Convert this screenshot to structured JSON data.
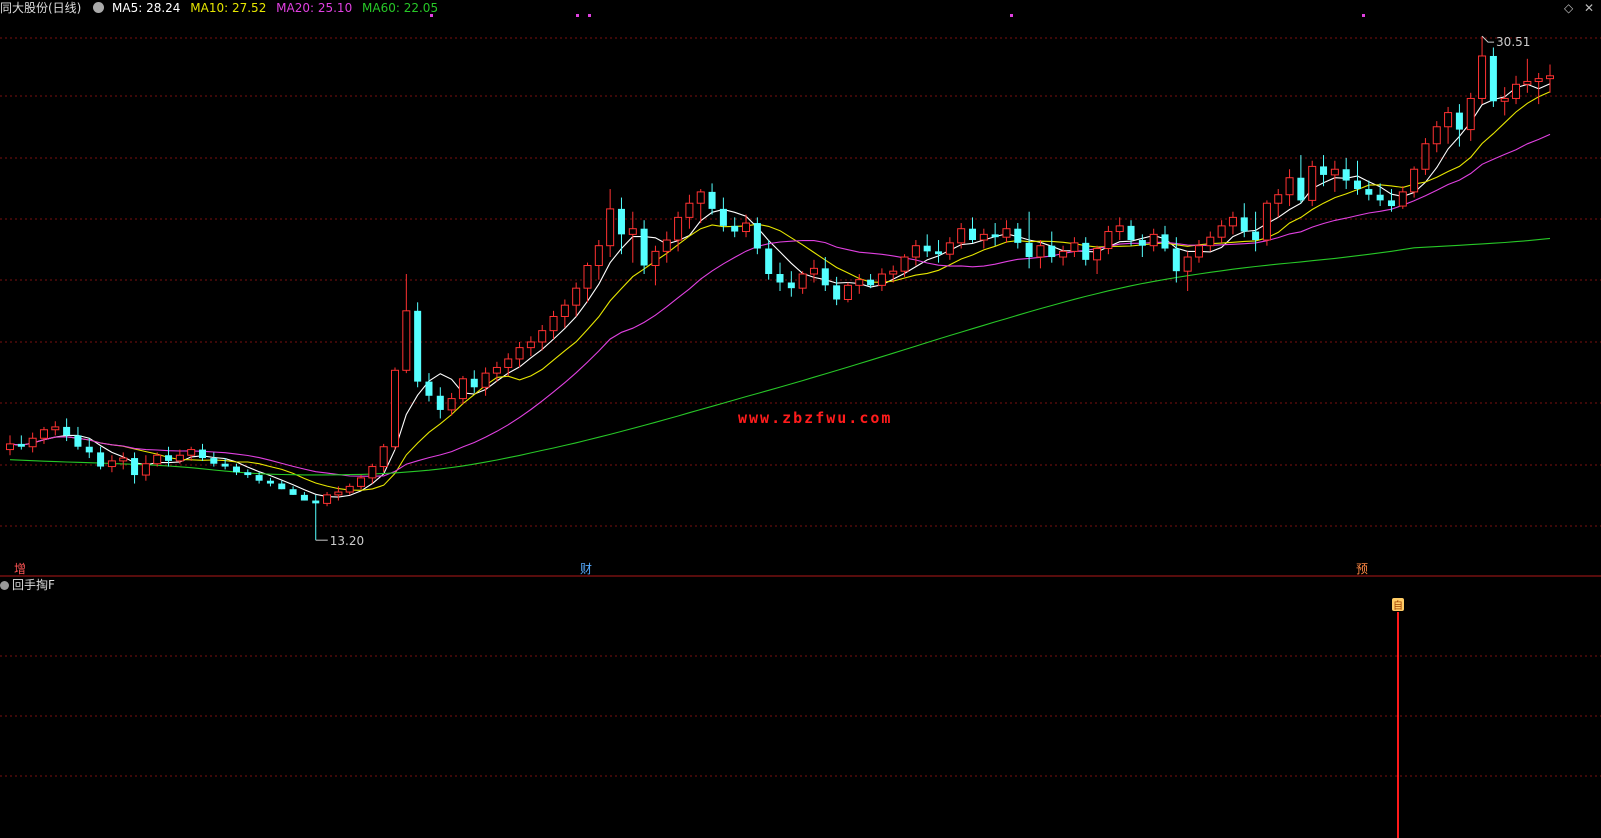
{
  "header": {
    "stock_title": "同大股份(日线)",
    "ma_labels": [
      {
        "text": "MA5: 28.24",
        "color": "#ffffff"
      },
      {
        "text": "MA10: 27.52",
        "color": "#e6e600"
      },
      {
        "text": "MA20: 25.10",
        "color": "#e040e0"
      },
      {
        "text": "MA60: 22.05",
        "color": "#27c727"
      }
    ],
    "settings_icon": "diamond-icon",
    "close_icon": "x-icon"
  },
  "annotations": {
    "high_label": "30.51",
    "low_label": "13.20",
    "event_tags": [
      {
        "text": "增",
        "color": "#ff5555"
      },
      {
        "text": "财",
        "color": "#55aaff"
      },
      {
        "text": "预",
        "color": "#ff8844"
      }
    ],
    "watermark": "www.zbzfwu.com"
  },
  "indicator": {
    "name": "回手掏F",
    "signal_marker": "自"
  },
  "chart_data": {
    "type": "candlestick",
    "ylim": [
      12.5,
      31.5
    ],
    "candles": [
      [
        16.4,
        16.9,
        16.2,
        16.6
      ],
      [
        16.6,
        16.9,
        16.4,
        16.5
      ],
      [
        16.5,
        17.0,
        16.3,
        16.8
      ],
      [
        16.8,
        17.2,
        16.6,
        17.1
      ],
      [
        17.1,
        17.4,
        16.9,
        17.2
      ],
      [
        17.2,
        17.5,
        16.7,
        16.9
      ],
      [
        16.9,
        17.2,
        16.4,
        16.5
      ],
      [
        16.5,
        16.8,
        16.1,
        16.3
      ],
      [
        16.3,
        16.5,
        15.7,
        15.8
      ],
      [
        15.8,
        16.2,
        15.6,
        16.0
      ],
      [
        16.0,
        16.3,
        15.7,
        16.1
      ],
      [
        16.1,
        16.3,
        15.2,
        15.5
      ],
      [
        15.5,
        16.2,
        15.3,
        15.9
      ],
      [
        15.9,
        16.3,
        15.8,
        16.2
      ],
      [
        16.2,
        16.5,
        15.8,
        16.0
      ],
      [
        16.0,
        16.4,
        15.9,
        16.2
      ],
      [
        16.2,
        16.5,
        16.0,
        16.4
      ],
      [
        16.4,
        16.6,
        16.0,
        16.1
      ],
      [
        16.1,
        16.3,
        15.8,
        15.9
      ],
      [
        15.9,
        16.1,
        15.7,
        15.8
      ],
      [
        15.8,
        15.9,
        15.5,
        15.6
      ],
      [
        15.6,
        15.7,
        15.4,
        15.5
      ],
      [
        15.5,
        15.6,
        15.2,
        15.3
      ],
      [
        15.3,
        15.4,
        15.1,
        15.2
      ],
      [
        15.2,
        15.3,
        15.0,
        15.0
      ],
      [
        15.0,
        15.1,
        14.8,
        14.8
      ],
      [
        14.8,
        14.9,
        14.6,
        14.6
      ],
      [
        14.6,
        14.8,
        13.2,
        14.5
      ],
      [
        14.5,
        14.9,
        14.4,
        14.8
      ],
      [
        14.8,
        15.1,
        14.6,
        14.9
      ],
      [
        14.9,
        15.2,
        14.8,
        15.1
      ],
      [
        15.1,
        15.5,
        15.0,
        15.4
      ],
      [
        15.4,
        15.9,
        15.2,
        15.8
      ],
      [
        15.8,
        16.6,
        15.6,
        16.5
      ],
      [
        16.5,
        19.3,
        16.4,
        19.2
      ],
      [
        19.2,
        22.6,
        19.1,
        21.3
      ],
      [
        21.3,
        21.6,
        18.6,
        18.8
      ],
      [
        18.8,
        19.1,
        18.1,
        18.3
      ],
      [
        18.3,
        18.6,
        17.5,
        17.8
      ],
      [
        17.8,
        18.4,
        17.6,
        18.2
      ],
      [
        18.2,
        19.0,
        18.0,
        18.9
      ],
      [
        18.9,
        19.2,
        18.4,
        18.6
      ],
      [
        18.6,
        19.3,
        18.3,
        19.1
      ],
      [
        19.1,
        19.5,
        18.8,
        19.3
      ],
      [
        19.3,
        19.8,
        19.0,
        19.6
      ],
      [
        19.6,
        20.2,
        19.3,
        20.0
      ],
      [
        20.0,
        20.4,
        19.7,
        20.2
      ],
      [
        20.2,
        20.8,
        19.9,
        20.6
      ],
      [
        20.6,
        21.3,
        20.3,
        21.1
      ],
      [
        21.1,
        21.7,
        20.7,
        21.5
      ],
      [
        21.5,
        22.3,
        21.1,
        22.1
      ],
      [
        22.1,
        23.0,
        21.6,
        22.9
      ],
      [
        22.9,
        23.8,
        22.4,
        23.6
      ],
      [
        23.6,
        25.6,
        23.2,
        24.9
      ],
      [
        24.9,
        25.3,
        23.3,
        24.0
      ],
      [
        24.0,
        24.8,
        23.0,
        24.2
      ],
      [
        24.2,
        24.5,
        22.6,
        22.9
      ],
      [
        22.9,
        23.6,
        22.2,
        23.4
      ],
      [
        23.4,
        24.1,
        23.0,
        23.8
      ],
      [
        23.8,
        24.8,
        23.4,
        24.6
      ],
      [
        24.6,
        25.4,
        24.2,
        25.1
      ],
      [
        25.1,
        25.6,
        24.4,
        25.5
      ],
      [
        25.5,
        25.8,
        24.7,
        24.9
      ],
      [
        24.9,
        25.3,
        24.1,
        24.3
      ],
      [
        24.3,
        24.6,
        23.9,
        24.1
      ],
      [
        24.1,
        24.7,
        23.9,
        24.4
      ],
      [
        24.4,
        24.6,
        23.3,
        23.5
      ],
      [
        23.5,
        23.8,
        22.4,
        22.6
      ],
      [
        22.6,
        23.0,
        22.0,
        22.3
      ],
      [
        22.3,
        22.7,
        21.8,
        22.1
      ],
      [
        22.1,
        22.7,
        21.9,
        22.6
      ],
      [
        22.6,
        23.1,
        22.3,
        22.8
      ],
      [
        22.8,
        23.2,
        22.0,
        22.2
      ],
      [
        22.2,
        22.5,
        21.5,
        21.7
      ],
      [
        21.7,
        22.3,
        21.6,
        22.2
      ],
      [
        22.2,
        22.6,
        21.9,
        22.4
      ],
      [
        22.4,
        22.6,
        22.1,
        22.2
      ],
      [
        22.2,
        22.8,
        22.0,
        22.6
      ],
      [
        22.6,
        22.9,
        22.3,
        22.7
      ],
      [
        22.7,
        23.3,
        22.5,
        23.2
      ],
      [
        23.2,
        23.8,
        22.9,
        23.6
      ],
      [
        23.6,
        24.0,
        23.2,
        23.4
      ],
      [
        23.4,
        23.8,
        23.0,
        23.3
      ],
      [
        23.3,
        23.9,
        23.1,
        23.7
      ],
      [
        23.7,
        24.4,
        23.5,
        24.2
      ],
      [
        24.2,
        24.6,
        23.7,
        23.8
      ],
      [
        23.8,
        24.2,
        23.5,
        24.0
      ],
      [
        24.0,
        24.4,
        23.6,
        23.9
      ],
      [
        23.9,
        24.5,
        23.7,
        24.2
      ],
      [
        24.2,
        24.4,
        23.5,
        23.7
      ],
      [
        23.7,
        24.8,
        22.8,
        23.2
      ],
      [
        23.2,
        23.8,
        22.8,
        23.6
      ],
      [
        23.6,
        24.1,
        23.0,
        23.2
      ],
      [
        23.2,
        23.6,
        22.9,
        23.4
      ],
      [
        23.4,
        23.9,
        23.2,
        23.7
      ],
      [
        23.7,
        23.9,
        22.9,
        23.1
      ],
      [
        23.1,
        23.6,
        22.6,
        23.5
      ],
      [
        23.5,
        24.3,
        23.3,
        24.1
      ],
      [
        24.1,
        24.6,
        23.8,
        24.3
      ],
      [
        24.3,
        24.5,
        23.6,
        23.8
      ],
      [
        23.8,
        24.0,
        23.2,
        23.6
      ],
      [
        23.6,
        24.2,
        23.4,
        24.0
      ],
      [
        24.0,
        24.3,
        23.4,
        23.5
      ],
      [
        23.5,
        23.9,
        22.3,
        22.7
      ],
      [
        22.7,
        23.4,
        22.0,
        23.2
      ],
      [
        23.2,
        23.8,
        23.0,
        23.6
      ],
      [
        23.6,
        24.1,
        23.4,
        23.9
      ],
      [
        23.9,
        24.5,
        23.7,
        24.3
      ],
      [
        24.3,
        24.8,
        24.0,
        24.6
      ],
      [
        24.6,
        25.1,
        23.9,
        24.1
      ],
      [
        24.1,
        24.8,
        23.4,
        23.8
      ],
      [
        23.8,
        25.2,
        23.6,
        25.1
      ],
      [
        25.1,
        25.6,
        24.6,
        25.4
      ],
      [
        25.4,
        26.3,
        25.0,
        26.0
      ],
      [
        26.0,
        26.8,
        25.1,
        25.2
      ],
      [
        25.2,
        26.6,
        25.0,
        26.4
      ],
      [
        26.4,
        26.8,
        25.7,
        26.1
      ],
      [
        26.1,
        26.6,
        25.5,
        26.3
      ],
      [
        26.3,
        26.7,
        25.6,
        25.9
      ],
      [
        25.9,
        26.6,
        25.4,
        25.6
      ],
      [
        25.6,
        25.9,
        25.2,
        25.4
      ],
      [
        25.4,
        25.8,
        25.0,
        25.2
      ],
      [
        25.2,
        25.6,
        24.8,
        25.0
      ],
      [
        25.0,
        25.7,
        24.9,
        25.5
      ],
      [
        25.5,
        26.4,
        25.3,
        26.3
      ],
      [
        26.3,
        27.4,
        26.1,
        27.2
      ],
      [
        27.2,
        28.0,
        26.9,
        27.8
      ],
      [
        27.8,
        28.5,
        27.2,
        28.3
      ],
      [
        28.3,
        28.6,
        27.1,
        27.7
      ],
      [
        27.7,
        29.0,
        27.3,
        28.8
      ],
      [
        28.8,
        31.0,
        28.6,
        30.3
      ],
      [
        30.3,
        30.6,
        28.5,
        28.7
      ],
      [
        28.7,
        29.2,
        28.2,
        28.8
      ],
      [
        28.8,
        29.6,
        28.6,
        29.3
      ],
      [
        29.3,
        30.2,
        29.0,
        29.4
      ],
      [
        29.4,
        29.7,
        28.6,
        29.5
      ],
      [
        29.5,
        30.0,
        29.0,
        29.6
      ]
    ],
    "ma_series": [
      {
        "name": "MA5",
        "color": "#ffffff"
      },
      {
        "name": "MA10",
        "color": "#e6e600"
      },
      {
        "name": "MA20",
        "color": "#e040e0"
      },
      {
        "name": "MA60",
        "color": "#27c727"
      }
    ]
  }
}
